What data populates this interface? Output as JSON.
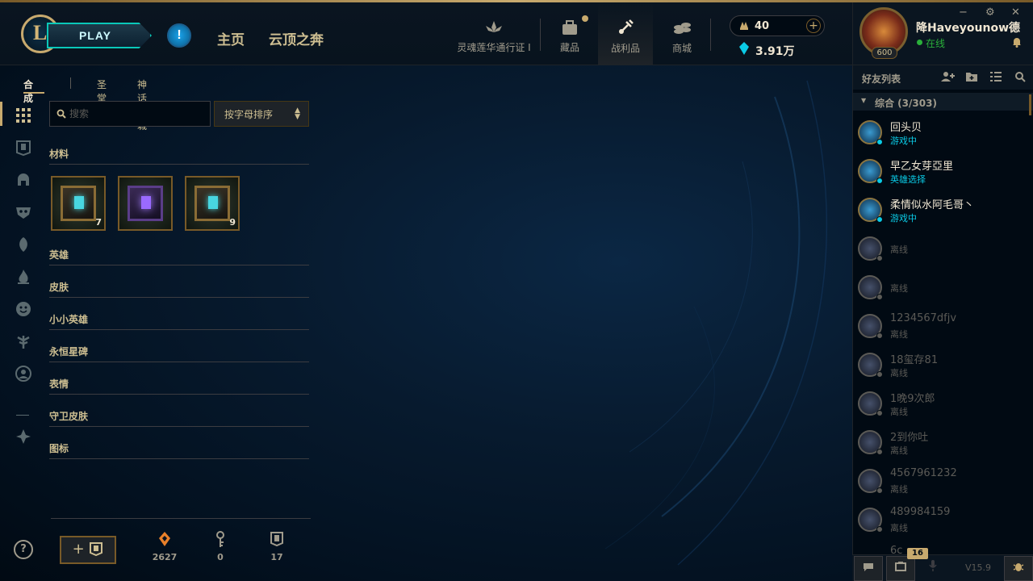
{
  "header": {
    "logo_letter": "L",
    "play_label": "PLAY",
    "alert_symbol": "!",
    "nav_home": "主页",
    "nav_tft": "云顶之奔",
    "nav_icons": [
      {
        "label": "灵魂莲华通行证 I",
        "icon": "lotus-icon"
      },
      {
        "label": "藏品",
        "icon": "collection-bag-icon"
      },
      {
        "label": "战利品",
        "icon": "loot-icon"
      },
      {
        "label": "商城",
        "icon": "store-coins-icon"
      }
    ],
    "rp_amount": "40",
    "rp_plus": "+",
    "be_amount": "3.91万"
  },
  "profile": {
    "username": "降Haveyounow德",
    "status": "在线",
    "level": "600",
    "window_controls": [
      "−",
      "⚙",
      "✕"
    ]
  },
  "loot": {
    "subtabs": [
      "合成",
      "圣堂",
      "神话商城"
    ],
    "search_placeholder": "搜索",
    "sort_label": "按字母排序",
    "categories": [
      "材料",
      "英雄",
      "皮肤",
      "小小英雄",
      "永恒星碑",
      "表情",
      "守卫皮肤",
      "图标"
    ],
    "items": [
      {
        "name": "hextech-chest",
        "count": "7"
      },
      {
        "name": "masterwork-chest",
        "count": ""
      },
      {
        "name": "hextech-chest",
        "count": "9"
      }
    ],
    "footer": {
      "help_symbol": "?",
      "add_symbol": "+",
      "essence": "2627",
      "keys": "0",
      "chests": "17"
    }
  },
  "friends": {
    "title": "好友列表",
    "group_label": "综合 (3/303)",
    "list": [
      {
        "name": "回头贝",
        "status": "游戏中",
        "online": true
      },
      {
        "name": "早乙女芽亞里",
        "status": "英雄选择",
        "online": true
      },
      {
        "name": "柔情似水阿毛哥丶",
        "status": "游戏中",
        "online": true
      },
      {
        "name": "",
        "status": "离线",
        "online": false
      },
      {
        "name": "",
        "status": "离线",
        "online": false
      },
      {
        "name": "1234567dfjv",
        "status": "离线",
        "online": false
      },
      {
        "name": "18玺存81",
        "status": "离线",
        "online": false
      },
      {
        "name": "1晚9次郎",
        "status": "离线",
        "online": false
      },
      {
        "name": "2到你吐",
        "status": "离线",
        "online": false
      },
      {
        "name": "4567961232",
        "status": "离线",
        "online": false
      },
      {
        "name": "489984159",
        "status": "离线",
        "online": false
      }
    ],
    "partial_last_name": "6c",
    "badge_count": "16",
    "version": "V15.9"
  },
  "colors": {
    "gold": "#c8aa6e",
    "teal": "#0ac8b9",
    "online_blue": "#0acbe6",
    "online_green": "#2ab03a"
  }
}
